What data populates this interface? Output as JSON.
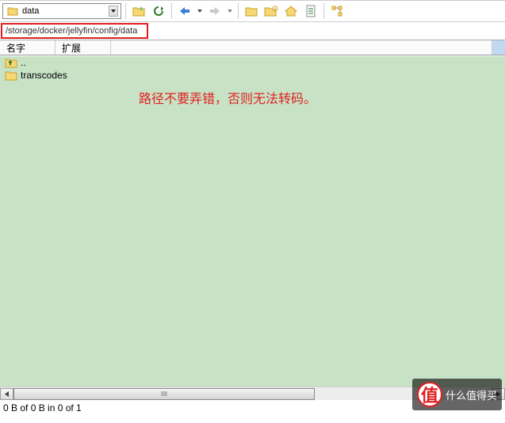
{
  "toolbar": {
    "current_folder": "data"
  },
  "address": {
    "path": "/storage/docker/jellyfin/config/data"
  },
  "columns": {
    "name": "名字",
    "ext": "扩展"
  },
  "files": [
    {
      "icon": "parent-folder-icon",
      "name": ".."
    },
    {
      "icon": "folder-icon",
      "name": "transcodes"
    }
  ],
  "annotation": "路径不要弄错，否则无法转码。",
  "status": "0 B of 0 B in 0 of 1",
  "watermark": "什么值得买"
}
